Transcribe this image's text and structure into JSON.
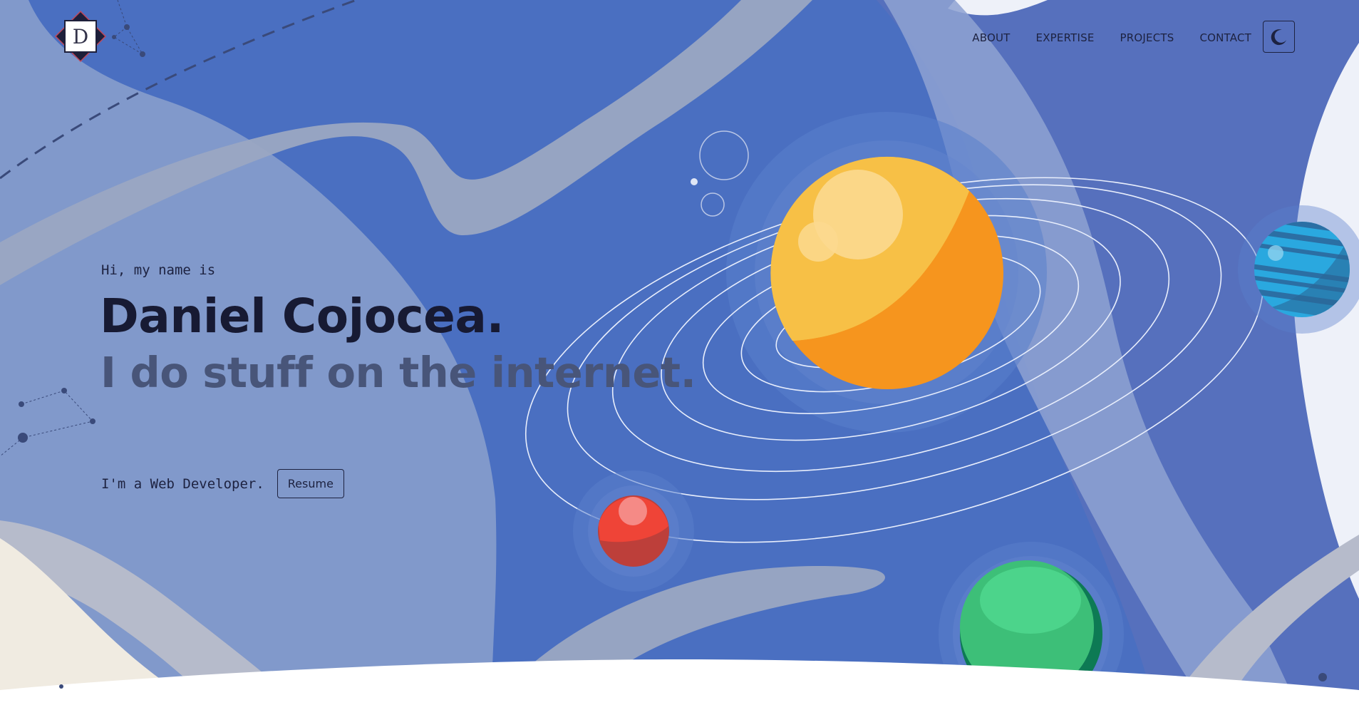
{
  "brand": {
    "logo_letter": "D"
  },
  "nav": {
    "items": [
      {
        "label": "ABOUT"
      },
      {
        "label": "EXPERTISE"
      },
      {
        "label": "PROJECTS"
      },
      {
        "label": "CONTACT"
      }
    ],
    "theme_toggle_icon": "moon-icon"
  },
  "hero": {
    "greeting": "Hi, my name is",
    "name": "Daniel Cojocea.",
    "tagline": "I do stuff on the internet.",
    "role": "I'm a Web Developer.",
    "resume_label": "Resume"
  },
  "colors": {
    "sky": "#4a6fc1",
    "wave_light": "#8199cb",
    "wave_grey": "#9aa6c2",
    "sun": "#f7c046",
    "sun_shadow": "#f6951e",
    "red_planet": "#ef4437",
    "green_planet": "#3dbf78",
    "blue_planet": "#2aa8df",
    "text_dark": "#171a33",
    "text_muted": "#485579"
  }
}
